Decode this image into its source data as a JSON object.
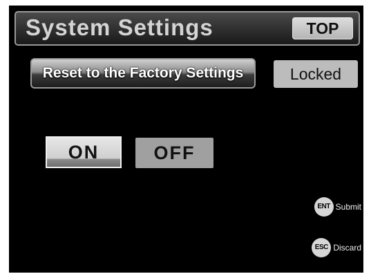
{
  "header": {
    "title": "System Settings",
    "top_button_label": "TOP"
  },
  "reset": {
    "button_label": "Reset to the Factory Settings",
    "status_label": "Locked"
  },
  "toggle": {
    "on_label": "ON",
    "off_label": "OFF",
    "selected": "ON"
  },
  "hints": {
    "submit_key": "ENT",
    "submit_label": "Submit",
    "discard_key": "ESC",
    "discard_label": "Discard"
  },
  "colors": {
    "background": "#000000",
    "button_gray": "#a0a0a0",
    "text_light": "#d4d4d4"
  }
}
